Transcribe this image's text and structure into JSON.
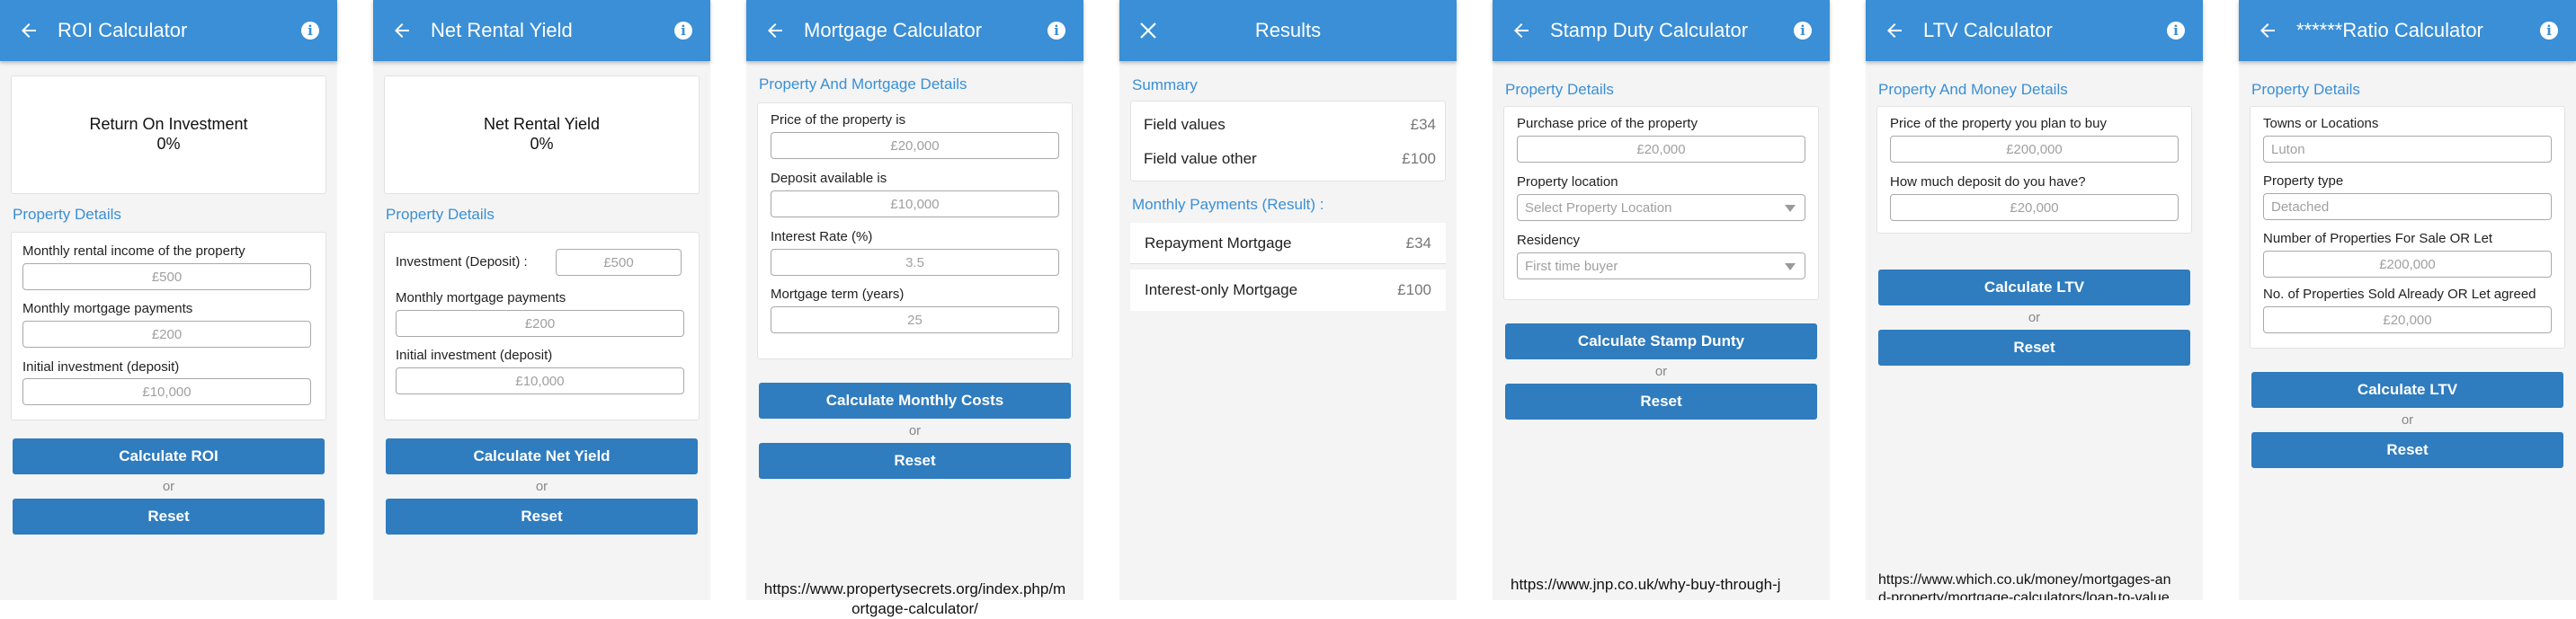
{
  "colors": {
    "appbar": "#3a8fd6",
    "button": "#2f7cbf",
    "section": "#3a8fd6"
  },
  "roi": {
    "title": "ROI Calculator",
    "result_label": "Return On Investment",
    "result_value": "0%",
    "section": "Property Details",
    "fields": [
      {
        "label": "Monthly rental income of the property",
        "placeholder": "£500"
      },
      {
        "label": "Monthly mortgage payments",
        "placeholder": "£200"
      },
      {
        "label": "Initial investment (deposit)",
        "placeholder": "£10,000"
      }
    ],
    "calc_button": "Calculate ROI",
    "or": "or",
    "reset_button": "Reset"
  },
  "yield": {
    "title": "Net Rental Yield",
    "result_label": "Net Rental Yield",
    "result_value": "0%",
    "section": "Property Details",
    "fields": [
      {
        "label": "Investment (Deposit) :",
        "placeholder": "£500"
      },
      {
        "label": "Monthly mortgage payments",
        "placeholder": "£200"
      },
      {
        "label": "Initial investment (deposit)",
        "placeholder": "£10,000"
      }
    ],
    "calc_button": "Calculate Net Yield",
    "or": "or",
    "reset_button": "Reset"
  },
  "mortgage": {
    "title": "Mortgage Calculator",
    "section": "Property And Mortgage Details",
    "fields": [
      {
        "label": "Price of the property is",
        "placeholder": "£20,000"
      },
      {
        "label": "Deposit available is",
        "placeholder": "£10,000"
      },
      {
        "label": "Interest Rate (%)",
        "placeholder": "3.5"
      },
      {
        "label": "Mortgage term (years)",
        "placeholder": "25"
      }
    ],
    "calc_button": "Calculate Monthly Costs",
    "or": "or",
    "reset_button": "Reset",
    "url_line1": "https://www.propertysecrets.org/index.php/m",
    "url_line2": "ortgage-calculator/"
  },
  "results": {
    "title": "Results",
    "summary_title": "Summary",
    "summary": [
      {
        "label": "Field values",
        "value": "£34"
      },
      {
        "label": "Field value other",
        "value": "£100"
      }
    ],
    "monthly_title": "Monthly Payments (Result) :",
    "monthly": [
      {
        "label": "Repayment Mortgage",
        "value": "£34"
      },
      {
        "label": "Interest-only Mortgage",
        "value": "£100"
      }
    ]
  },
  "stamp": {
    "title": "Stamp Duty Calculator",
    "section": "Property Details",
    "fields": [
      {
        "label": "Purchase price of the property",
        "placeholder": "£20,000"
      },
      {
        "label": "Property location",
        "placeholder": "Select Property Location"
      },
      {
        "label": "Residency",
        "placeholder": "First time buyer"
      }
    ],
    "calc_button": "Calculate Stamp Dunty",
    "or": "or",
    "reset_button": "Reset",
    "url": "https://www.jnp.co.uk/why-buy-through-j"
  },
  "ltv": {
    "title": "LTV Calculator",
    "section": "Property And Money Details",
    "fields": [
      {
        "label": "Price of the property you plan to buy",
        "placeholder": "£200,000"
      },
      {
        "label": "How much deposit do you have?",
        "placeholder": "£20,000"
      }
    ],
    "calc_button": "Calculate LTV",
    "or": "or",
    "reset_button": "Reset",
    "url_line1": "https://www.which.co.uk/money/mortgages-an",
    "url_line2": "d-property/mortgage-calculators/loan-to-value"
  },
  "ratio": {
    "title": "******Ratio Calculator",
    "section": "Property Details",
    "fields": [
      {
        "label": "Towns or Locations",
        "placeholder": "Luton"
      },
      {
        "label": "Property type",
        "placeholder": "Detached"
      },
      {
        "label": "Number of Properties For Sale OR Let",
        "placeholder": "£200,000"
      },
      {
        "label": "No. of Properties Sold Already OR Let agreed",
        "placeholder": "£20,000"
      }
    ],
    "calc_button": "Calculate LTV",
    "or": "or",
    "reset_button": "Reset"
  }
}
